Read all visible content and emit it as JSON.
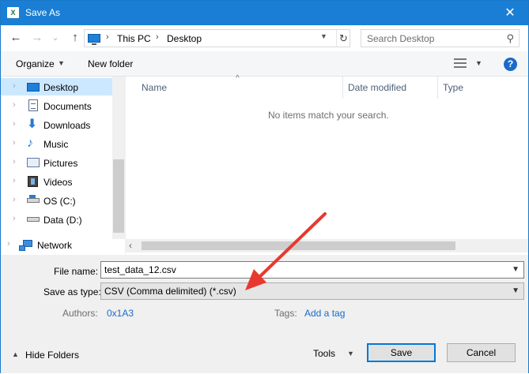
{
  "window": {
    "title": "Save As",
    "app_icon": "Xᴇ"
  },
  "nav_buttons": {
    "back": "←",
    "forward": "→",
    "recent": "˅",
    "up": "↑"
  },
  "address": {
    "crumbs": [
      "This PC",
      "Desktop"
    ],
    "separator": ">"
  },
  "search": {
    "placeholder": "Search Desktop"
  },
  "toolbar": {
    "organize": "Organize",
    "new_folder": "New folder"
  },
  "sidebar": {
    "items": [
      {
        "label": "Desktop",
        "icon": "desktop-icon",
        "selected": true
      },
      {
        "label": "Documents",
        "icon": "documents-icon"
      },
      {
        "label": "Downloads",
        "icon": "downloads-icon"
      },
      {
        "label": "Music",
        "icon": "music-icon"
      },
      {
        "label": "Pictures",
        "icon": "pictures-icon"
      },
      {
        "label": "Videos",
        "icon": "videos-icon"
      },
      {
        "label": "OS (C:)",
        "icon": "drive-c-icon"
      },
      {
        "label": "Data (D:)",
        "icon": "drive-d-icon"
      },
      {
        "label": "Network",
        "icon": "network-icon"
      }
    ]
  },
  "filelist": {
    "columns": [
      "Name",
      "Date modified",
      "Type"
    ],
    "empty_message": "No items match your search."
  },
  "form": {
    "file_name_label": "File name:",
    "file_name_value": "test_data_12.csv",
    "save_type_label": "Save as type:",
    "save_type_value": "CSV (Comma delimited) (*.csv)",
    "authors_label": "Authors:",
    "authors_value": "0x1A3",
    "tags_label": "Tags:",
    "tags_value": "Add a tag"
  },
  "footer": {
    "hide_folders": "Hide Folders",
    "tools": "Tools",
    "save": "Save",
    "cancel": "Cancel"
  },
  "colors": {
    "titlebar": "#1a7fd4",
    "selection": "#cce8ff",
    "annotation_arrow": "#e8392e",
    "link": "#1a6bc9"
  }
}
